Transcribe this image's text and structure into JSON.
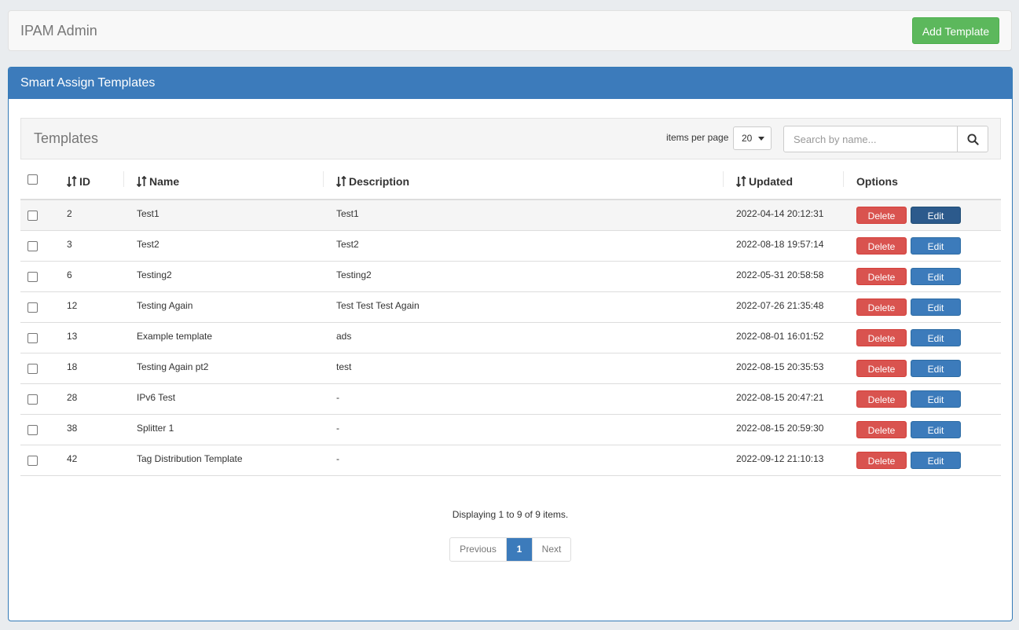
{
  "topbar": {
    "title": "IPAM Admin",
    "add_button": "Add Template"
  },
  "panel": {
    "title": "Smart Assign Templates"
  },
  "toolbar": {
    "title": "Templates",
    "items_per_page_label": "items per page",
    "items_per_page_value": "20",
    "search_placeholder": "Search by name..."
  },
  "table": {
    "columns": {
      "id": "ID",
      "name": "Name",
      "description": "Description",
      "updated": "Updated",
      "options": "Options"
    },
    "delete_label": "Delete",
    "edit_label": "Edit",
    "rows": [
      {
        "id": "2",
        "name": "Test1",
        "description": "Test1",
        "updated": "2022-04-14 20:12:31"
      },
      {
        "id": "3",
        "name": "Test2",
        "description": "Test2",
        "updated": "2022-08-18 19:57:14"
      },
      {
        "id": "6",
        "name": "Testing2",
        "description": "Testing2",
        "updated": "2022-05-31 20:58:58"
      },
      {
        "id": "12",
        "name": "Testing Again",
        "description": "Test Test Test Again",
        "updated": "2022-07-26 21:35:48"
      },
      {
        "id": "13",
        "name": "Example template",
        "description": "ads",
        "updated": "2022-08-01 16:01:52"
      },
      {
        "id": "18",
        "name": "Testing Again pt2",
        "description": "test",
        "updated": "2022-08-15 20:35:53"
      },
      {
        "id": "28",
        "name": "IPv6 Test",
        "description": "-",
        "updated": "2022-08-15 20:47:21"
      },
      {
        "id": "38",
        "name": "Splitter 1",
        "description": "-",
        "updated": "2022-08-15 20:59:30"
      },
      {
        "id": "42",
        "name": "Tag Distribution Template",
        "description": "-",
        "updated": "2022-09-12 21:10:13"
      }
    ]
  },
  "pagination": {
    "summary": "Displaying 1 to 9 of 9 items.",
    "previous": "Previous",
    "current": "1",
    "next": "Next"
  },
  "colors": {
    "primary": "#3c7bbb",
    "success": "#5cb85c",
    "danger": "#d9534f"
  }
}
